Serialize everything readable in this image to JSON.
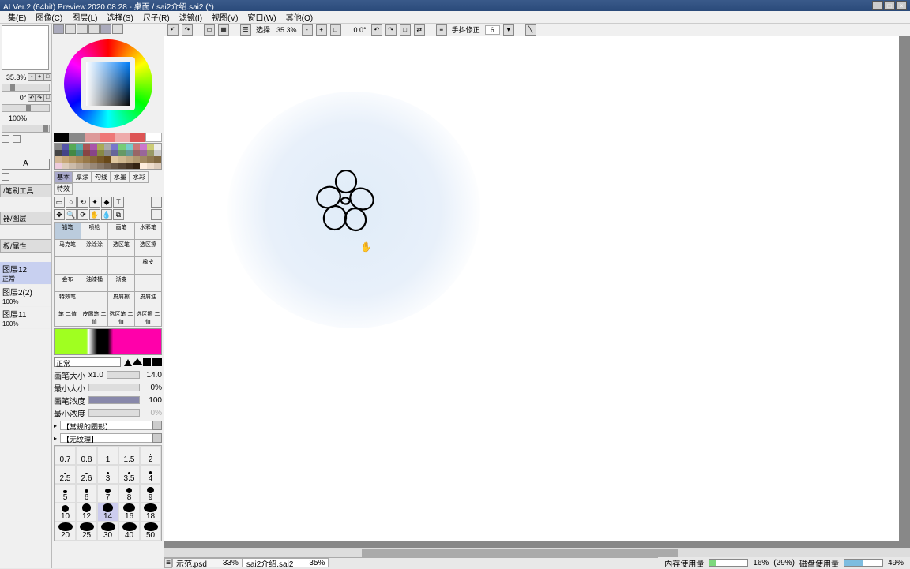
{
  "title": "AI Ver.2 (64bit) Preview.2020.08.28 - 桌面 / sai2介绍.sai2 (*)",
  "menu": [
    "集(E)",
    "图像(C)",
    "图层(L)",
    "选择(S)",
    "尺子(R)",
    "滤镜(I)",
    "视图(V)",
    "窗口(W)",
    "其他(O)"
  ],
  "nav": {
    "zoom": "35.3%",
    "angle": "0°",
    "opacity": "100%"
  },
  "leftPanels": [
    "/笔刷工具",
    "器/图层",
    "板/属性"
  ],
  "layers": [
    {
      "name": "图层12",
      "sub": "正常",
      "sel": true
    },
    {
      "name": "图层2(2)",
      "sub": "100%"
    },
    {
      "name": "图层11",
      "sub": "100%"
    }
  ],
  "toolTabs": [
    "基本",
    "厚涂",
    "勾线",
    "水墨",
    "水彩",
    "特效"
  ],
  "brushNames": [
    "铅笔",
    "喷枪",
    "画笔",
    "水彩笔",
    "马克笔",
    "涂涂涂",
    "选区笔",
    "选区擦",
    "",
    "",
    "",
    "橡皮",
    "会布",
    "油漆桶",
    "渐变",
    "",
    "特效笔",
    "",
    "皮屑擦",
    "皮屑油",
    "笔 二值",
    "皮屑笔 二值",
    "选区笔 二值",
    "选区擦 二值"
  ],
  "blendMode": "正常",
  "params": {
    "sizeLabel": "画笔大小",
    "sizeMul": "x1.0",
    "sizeVal": "14.0",
    "minSizeLabel": "最小大小",
    "minSizeVal": "0%",
    "densLabel": "画笔浓度",
    "densVal": "100",
    "minDensLabel": "最小浓度",
    "minDensVal": "0%"
  },
  "exp1": "【常规的圆形】",
  "exp2": "【无纹理】",
  "brushSizes": [
    "0.7",
    "0.8",
    "1",
    "1.5",
    "2",
    "2.5",
    "2.6",
    "3",
    "3.5",
    "4",
    "5",
    "6",
    "7",
    "8",
    "9",
    "10",
    "12",
    "14",
    "16",
    "18",
    "20",
    "25",
    "30",
    "40",
    "50"
  ],
  "selectedSize": "14",
  "canvasToolbar": {
    "selLabel": "选择",
    "zoom": "35.3%",
    "angle": "0.0°",
    "stabLabel": "手抖修正",
    "stabVal": "6"
  },
  "tabs": [
    {
      "name": "示范.psd",
      "pct": "33%",
      "active": false
    },
    {
      "name": "sai2介绍.sai2",
      "pct": "35%",
      "active": true
    }
  ],
  "status": {
    "memLabel": "内存使用量",
    "memVal": "16%",
    "memAlt": "(29%)",
    "diskLabel": "磁盘使用量",
    "diskVal": "49%"
  }
}
